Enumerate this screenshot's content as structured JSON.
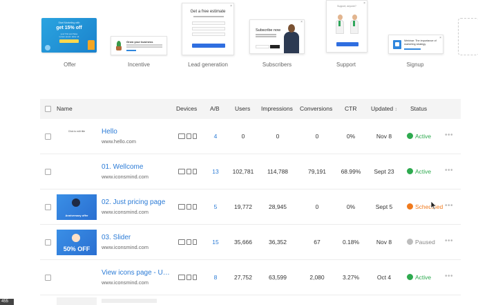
{
  "templates": [
    {
      "caption": "Offer",
      "preview": {
        "line1": "Start Marketing with",
        "big": "get 15% off",
        "line2": "your first purchase",
        "line3": "Lorem ipsum dolor sit"
      }
    },
    {
      "caption": "Incentive",
      "preview": {
        "title": "Grow your business"
      }
    },
    {
      "caption": "Lead generation",
      "preview": {
        "title": "Get a free estimate"
      }
    },
    {
      "caption": "Subscribers",
      "preview": {
        "title": "Subscribe now"
      }
    },
    {
      "caption": "Support",
      "preview": {
        "title": "Support, anyone?"
      }
    },
    {
      "caption": "Signup",
      "preview": {
        "title": "Webinar: The importance of marketing strategy"
      }
    }
  ],
  "table": {
    "headers": {
      "name": "Name",
      "devices": "Devices",
      "ab": "A/B",
      "users": "Users",
      "impressions": "Impressions",
      "conversions": "Conversions",
      "ctr": "CTR",
      "updated": "Updated",
      "updated_sort": "↕",
      "status": "Status"
    },
    "rows": [
      {
        "name": "Hello",
        "url": "www.hello.com",
        "ab": "4",
        "users": "0",
        "impressions": "0",
        "conversions": "0",
        "ctr": "0%",
        "updated": "Nov 8",
        "status": "Active",
        "status_kind": "active",
        "thumb_kind": "light",
        "thumb_text": "Click to edit title"
      },
      {
        "name": "01. Wellcome",
        "url": "www.iconsmind.com",
        "ab": "13",
        "users": "102,781",
        "impressions": "114,788",
        "conversions": "79,191",
        "ctr": "68.99%",
        "updated": "Sept 23",
        "status": "Active",
        "status_kind": "active",
        "thumb_kind": "light",
        "thumb_text": ""
      },
      {
        "name": "02. Just pricing page",
        "url": "www.iconsmind.com",
        "ab": "5",
        "users": "19,772",
        "impressions": "28,945",
        "conversions": "0",
        "ctr": "0%",
        "updated": "Sept 5",
        "status": "Scheduled",
        "status_kind": "sched",
        "thumb_kind": "blue",
        "thumb_text": "Anniversary offer"
      },
      {
        "name": "03. Slider",
        "url": "www.iconsmind.com",
        "ab": "15",
        "users": "35,666",
        "impressions": "36,352",
        "conversions": "67",
        "ctr": "0.18%",
        "updated": "Nov 8",
        "status": "Paused",
        "status_kind": "paused",
        "thumb_kind": "blue",
        "thumb_text": "50% OFF"
      },
      {
        "name": "View icons page - UPD...",
        "url": "www.iconsmind.com",
        "ab": "8",
        "users": "27,752",
        "impressions": "63,599",
        "conversions": "2,080",
        "ctr": "3.27%",
        "updated": "Oct 4",
        "status": "Active",
        "status_kind": "active",
        "thumb_kind": "light",
        "thumb_text": ""
      }
    ]
  },
  "footer_badge": "455",
  "colors": {
    "link": "#2b7bd6",
    "active": "#2eaa4f",
    "scheduled": "#f07a1c",
    "paused": "#888888",
    "header_bg": "#f4f4f4"
  },
  "icons": {
    "desktop": "desktop-icon",
    "tablet": "tablet-icon",
    "mobile": "mobile-icon",
    "more": "more-dots-icon",
    "sort": "sort-icon"
  }
}
